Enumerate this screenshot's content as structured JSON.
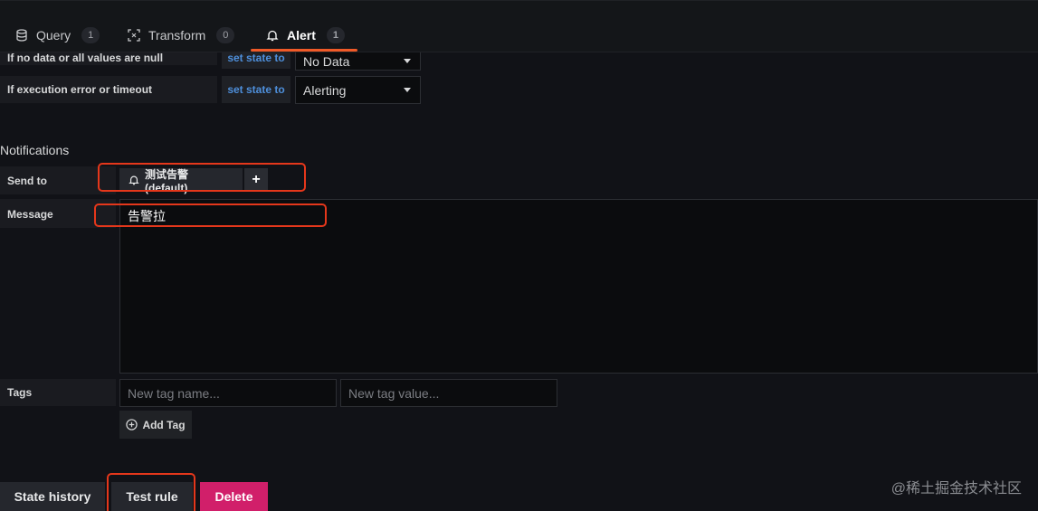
{
  "tabs": [
    {
      "label": "Query",
      "count": "1",
      "icon": "database-icon"
    },
    {
      "label": "Transform",
      "count": "0",
      "icon": "transform-icon"
    },
    {
      "label": "Alert",
      "count": "1",
      "icon": "bell-icon",
      "active": true
    }
  ],
  "no_data": {
    "label": "If no data or all values are null",
    "set_state_label": "set state to",
    "value": "No Data"
  },
  "exec_error": {
    "label": "If execution error or timeout",
    "set_state_label": "set state to",
    "value": "Alerting"
  },
  "notifications": {
    "title": "Notifications",
    "send_to_label": "Send to",
    "channel": "测试告警 (default)",
    "add_symbol": "+",
    "message_label": "Message",
    "message_value": "告警拉"
  },
  "tags": {
    "label": "Tags",
    "name_placeholder": "New tag name...",
    "value_placeholder": "New tag value...",
    "add_label": "Add Tag"
  },
  "footer": {
    "state_history": "State history",
    "test_rule": "Test rule",
    "delete": "Delete"
  },
  "watermark": "@稀土掘金技术社区",
  "colors": {
    "accent": "#f05a28",
    "link": "#4e8fdb",
    "danger": "#d11f6a",
    "highlight_box": "#e5371b"
  }
}
